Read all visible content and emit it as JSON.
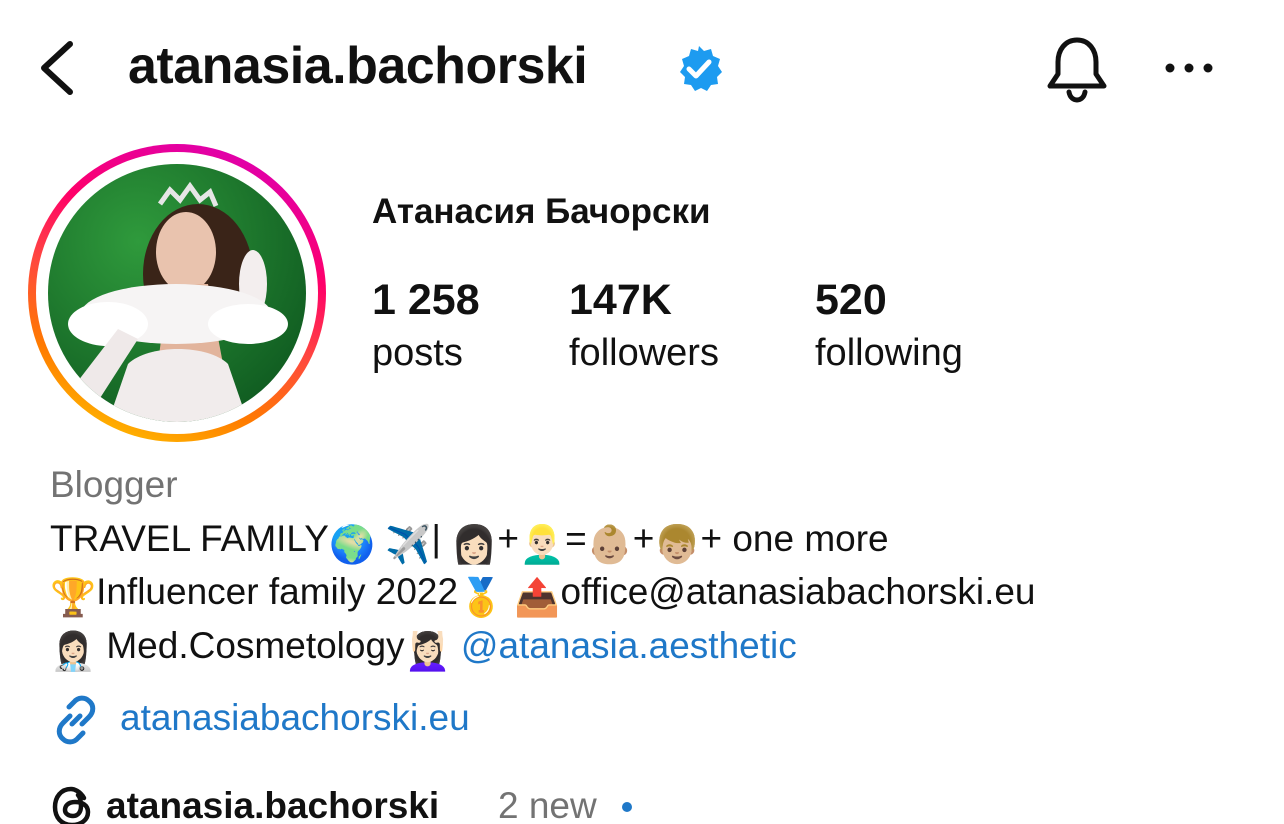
{
  "header": {
    "username": "atanasia.bachorski",
    "verified": true,
    "icons": [
      "back-chevron-icon",
      "verified-badge-icon",
      "bell-icon",
      "more-horizontal-icon"
    ]
  },
  "profile": {
    "full_name": "Атанасия Бачорски",
    "stats": {
      "posts": {
        "value": "1 258",
        "label": "posts"
      },
      "followers": {
        "value": "147K",
        "label": "followers"
      },
      "following": {
        "value": "520",
        "label": "following"
      }
    }
  },
  "bio": {
    "category": "Blogger",
    "line1": {
      "prefix": "TRAVEL FAMILY",
      "sep": "| ",
      "plus1": "+",
      "eq": "=",
      "plus2": "+",
      "suffix": "+ one more"
    },
    "line2": {
      "text1": "Influencer family 2022",
      "email": "office@atanasiabachorski.eu"
    },
    "line3": {
      "text": "Med.Cosmetology",
      "mention": "@atanasia.aesthetic"
    },
    "emoji": {
      "globe": "🌍",
      "plane": "✈️",
      "woman": "👩🏻",
      "man": "👱🏻‍♂️",
      "baby": "👶🏼",
      "boy": "👦🏼",
      "trophy": "🏆",
      "medal": "🥇",
      "outbox": "📤",
      "health_worker": "👩🏻‍⚕️",
      "massage": "💆🏻‍♀️"
    }
  },
  "link": {
    "text": "atanasiabachorski.eu",
    "icon": "link-icon"
  },
  "threads": {
    "username": "atanasia.bachorski",
    "new_label": "2 new",
    "icon": "threads-icon"
  },
  "colors": {
    "link_blue": "#1f78c8",
    "verified_blue": "#1d9bf0",
    "muted_gray": "#737373"
  }
}
